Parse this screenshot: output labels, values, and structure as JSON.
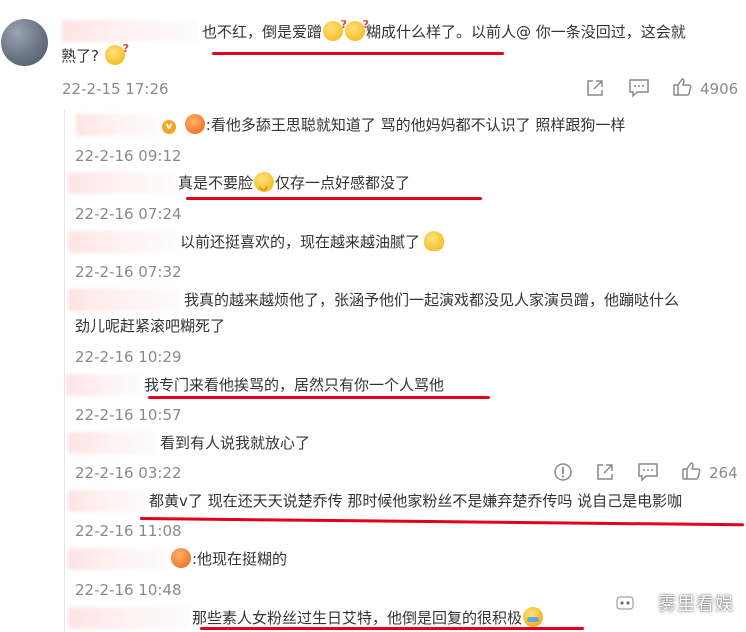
{
  "main_comment": {
    "text_segments": [
      "也不红，倒是爱蹭",
      "糊成什么样了。以前人@ 你一条没回过，这会就",
      "熟了?"
    ],
    "time": "22-2-15 17:26",
    "like_count": "4906"
  },
  "replies": [
    {
      "text": ":看他多舔王思聪就知道了 骂的他妈妈都不认识了 照样跟狗一样",
      "time": "22-2-16 09:12"
    },
    {
      "text_before": "真是不要脸",
      "text_after": "仅存一点好感都没了",
      "time": "22-2-16 07:24"
    },
    {
      "text": "以前还挺喜欢的，现在越来越油腻了",
      "time": "22-2-16 07:32"
    },
    {
      "text_line1": "我真的越来越烦他了，张涵予他们一起演戏都没见人家演员蹭，他蹦哒什么",
      "text_line2": "劲儿呢赶紧滚吧糊死了",
      "time": "22-2-16 10:29"
    },
    {
      "text": "我专门来看他挨骂的，居然只有你一个人骂他",
      "time": "22-2-16 10:57"
    },
    {
      "text": "看到有人说我就放心了",
      "time": "22-2-16 03:22",
      "like_count": "264"
    },
    {
      "text": "都黄v了 现在还天天说楚乔传 那时候他家粉丝不是嫌弃楚乔传吗 说自己是电影咖",
      "time": "22-2-16 11:08"
    },
    {
      "text": ":他现在挺糊的",
      "time": "22-2-16 10:48"
    },
    {
      "text": "那些素人女粉丝过生日艾特，他倒是回复的很积极"
    }
  ],
  "watermark": "雾里看娱",
  "colors": {
    "underline": "#e2001a",
    "time": "#8a8a8a",
    "text": "#333333"
  }
}
